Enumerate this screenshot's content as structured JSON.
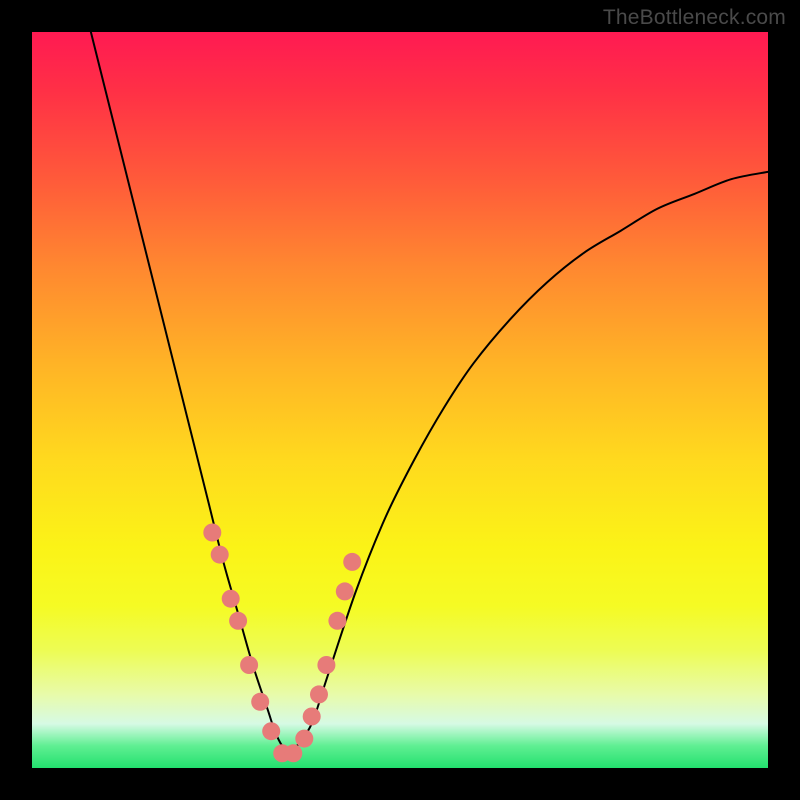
{
  "watermark": "TheBottleneck.com",
  "chart_data": {
    "type": "line",
    "title": "",
    "xlabel": "",
    "ylabel": "",
    "xlim": [
      0,
      100
    ],
    "ylim": [
      0,
      100
    ],
    "series": [
      {
        "name": "bottleneck-curve",
        "x": [
          8,
          10,
          12,
          14,
          16,
          18,
          20,
          22,
          24,
          26,
          28,
          30,
          32,
          33,
          34,
          35,
          36,
          38,
          40,
          44,
          48,
          52,
          56,
          60,
          65,
          70,
          75,
          80,
          85,
          90,
          95,
          100
        ],
        "y": [
          100,
          92,
          84,
          76,
          68,
          60,
          52,
          44,
          36,
          28,
          21,
          14,
          8,
          5,
          3,
          2,
          3,
          6,
          12,
          24,
          34,
          42,
          49,
          55,
          61,
          66,
          70,
          73,
          76,
          78,
          80,
          81
        ]
      }
    ],
    "markers": {
      "name": "highlight-points",
      "color": "#e77b79",
      "x": [
        24.5,
        25.5,
        27.0,
        28.0,
        29.5,
        31.0,
        32.5,
        34.0,
        35.5,
        37.0,
        38.0,
        39.0,
        40.0,
        41.5,
        42.5,
        43.5
      ],
      "y": [
        32,
        29,
        23,
        20,
        14,
        9,
        5,
        2,
        2,
        4,
        7,
        10,
        14,
        20,
        24,
        28
      ]
    }
  }
}
